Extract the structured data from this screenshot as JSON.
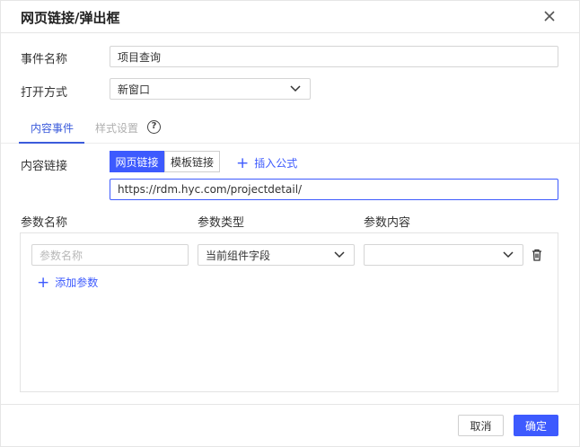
{
  "dialog": {
    "title": "网页链接/弹出框",
    "close_icon": "close-icon"
  },
  "form": {
    "event_name_label": "事件名称",
    "event_name_value": "项目查询",
    "open_mode_label": "打开方式",
    "open_mode_value": "新窗口"
  },
  "tabs": {
    "content_event": "内容事件",
    "style_settings": "样式设置",
    "help": "?"
  },
  "content_link": {
    "label": "内容链接",
    "segments": [
      "网页链接",
      "模板链接"
    ],
    "active_segment": "网页链接",
    "insert_formula": "插入公式",
    "url": "https://rdm.hyc.com/projectdetail/"
  },
  "params": {
    "headers": [
      "参数名称",
      "参数类型",
      "参数内容"
    ],
    "rows": [
      {
        "name_placeholder": "参数名称",
        "type_value": "当前组件字段",
        "content_value": ""
      }
    ],
    "add_label": "添加参数"
  },
  "footer": {
    "cancel_label": "取消",
    "ok_label": "确定"
  },
  "colors": {
    "accent": "#3d5afe",
    "border": "#d5d5d5",
    "placeholder": "#b8b8b8"
  }
}
